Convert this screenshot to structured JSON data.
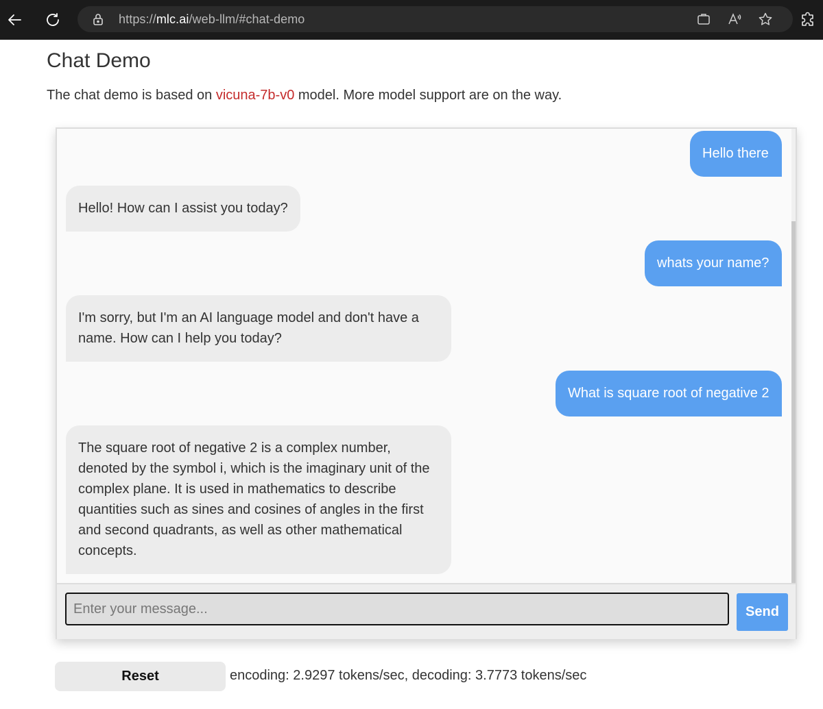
{
  "browser": {
    "url_prefix": "https://",
    "url_host": "mlc.ai",
    "url_path": "/web-llm/#chat-demo",
    "icons": [
      "back-arrow-icon",
      "reload-icon",
      "lock-icon",
      "tab-icon",
      "read-aloud-icon",
      "favorite-star-icon",
      "extensions-icon"
    ]
  },
  "page": {
    "title": "Chat Demo",
    "desc_before": "The chat demo is based on ",
    "model_link": "vicuna-7b-v0",
    "desc_after": " model. More model support are on the way."
  },
  "chat": {
    "messages": [
      {
        "role": "user",
        "text": "Hello there"
      },
      {
        "role": "bot",
        "text": "Hello! How can I assist you today?"
      },
      {
        "role": "user",
        "text": "whats your name?"
      },
      {
        "role": "bot",
        "text": "I'm sorry, but I'm an AI language model and don't have a name. How can I help you today?"
      },
      {
        "role": "user",
        "text": "What is square root of negative 2"
      },
      {
        "role": "bot",
        "text": "The square root of negative 2 is a complex number, denoted by the symbol i, which is the imaginary unit of the complex plane. It is used in mathematics to describe quantities such as sines and cosines of angles in the first and second quadrants, as well as other mathematical concepts."
      }
    ],
    "input_placeholder": "Enter your message...",
    "input_value": "",
    "send_label": "Send"
  },
  "footer": {
    "reset_label": "Reset",
    "stats": "encoding: 2.9297 tokens/sec, decoding: 3.7773 tokens/sec"
  },
  "colors": {
    "user_bubble": "#5aa0f0",
    "bot_bubble": "#ececec",
    "link": "#c42b2b"
  }
}
